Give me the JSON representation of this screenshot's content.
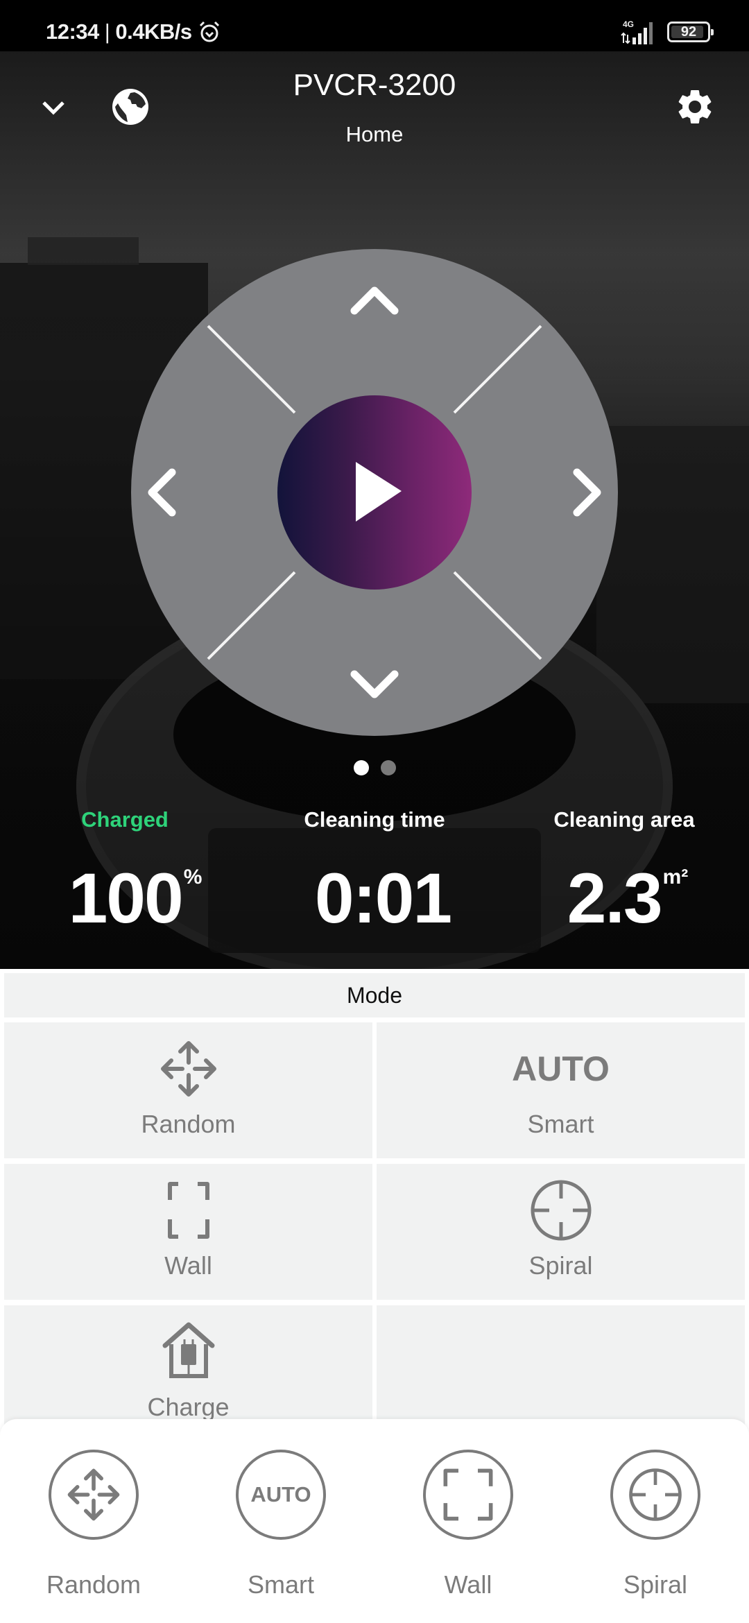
{
  "status_bar": {
    "time": "12:34",
    "speed": "0.4KB/s",
    "network": "4G",
    "battery": "92",
    "battery_level_percent": 92
  },
  "header": {
    "device_name": "PVCR-3200",
    "location": "Home",
    "icons": {
      "collapse": "chevron-down-icon",
      "globe": "globe-icon",
      "settings": "gear-icon"
    }
  },
  "dpad": {
    "icons": {
      "up": "chevron-up-icon",
      "down": "chevron-down-icon",
      "left": "chevron-left-icon",
      "right": "chevron-right-icon",
      "center": "play-icon"
    },
    "center_gradient": [
      "#12133a",
      "#8e2a7a"
    ]
  },
  "pager": {
    "pages": 2,
    "active": 0,
    "colors": {
      "active": "#ffffff",
      "inactive": "#7a7a7a"
    }
  },
  "stats": [
    {
      "label": "Charged",
      "value": "100",
      "unit": "%",
      "label_color": "#2ed37a"
    },
    {
      "label": "Cleaning time",
      "value": "0:01",
      "unit": "",
      "label_color": "#ffffff"
    },
    {
      "label": "Cleaning area",
      "value": "2.3",
      "unit": "m²",
      "label_color": "#ffffff"
    }
  ],
  "mode": {
    "title": "Mode",
    "items": [
      {
        "label": "Random",
        "icon": "random-arrows-icon"
      },
      {
        "label": "Smart",
        "icon": "auto-icon",
        "icon_text": "AUTO"
      },
      {
        "label": "Wall",
        "icon": "wall-corners-icon"
      },
      {
        "label": "Spiral",
        "icon": "crosshair-icon"
      },
      {
        "label": "Charge",
        "icon": "charge-home-icon"
      }
    ]
  },
  "quick_modes": {
    "items": [
      {
        "label": "Random",
        "icon": "random-arrows-icon"
      },
      {
        "label": "Smart",
        "icon": "auto-icon",
        "icon_text": "AUTO"
      },
      {
        "label": "Wall",
        "icon": "wall-corners-icon"
      },
      {
        "label": "Spiral",
        "icon": "crosshair-icon"
      }
    ]
  },
  "colors": {
    "icon_gray": "#7b7b7b",
    "cell_bg": "#f1f2f2",
    "dpad_bg": "#808184",
    "accent_green": "#2ed37a"
  }
}
